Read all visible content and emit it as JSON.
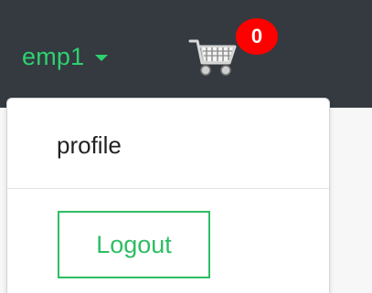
{
  "navbar": {
    "user_name": "emp1",
    "cart_icon": "shopping-cart-icon",
    "cart_count": "0"
  },
  "dropdown": {
    "profile_label": "profile",
    "logout_label": "Logout"
  },
  "colors": {
    "navbar_bg": "#343a40",
    "accent_green": "#2ed16f",
    "badge_red": "#ff0000"
  }
}
